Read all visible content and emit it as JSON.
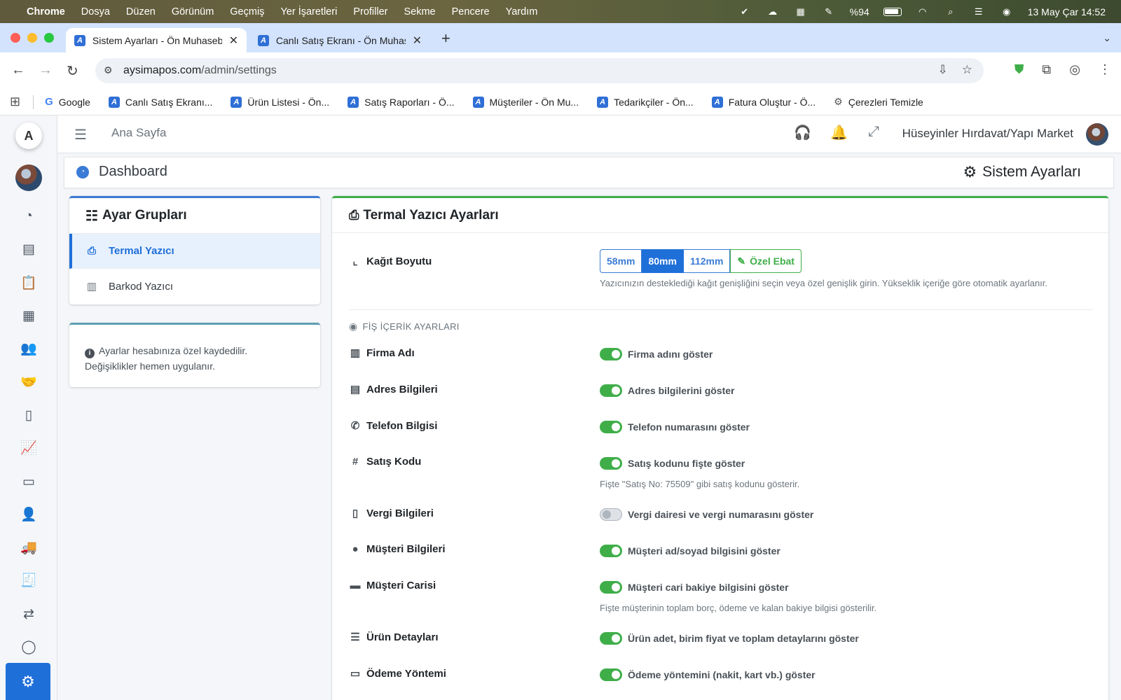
{
  "menubar": {
    "app": "Chrome",
    "items": [
      "Dosya",
      "Düzen",
      "Görünüm",
      "Geçmiş",
      "Yer İşaretleri",
      "Profiller",
      "Sekme",
      "Pencere",
      "Yardım"
    ],
    "battery": "%94",
    "datetime": "13 May Çar  14:52"
  },
  "tabs": [
    {
      "title": "Sistem Ayarları - Ön Muhaseb",
      "active": true
    },
    {
      "title": "Canlı Satış Ekranı - Ön Muhas",
      "active": false
    }
  ],
  "address": {
    "url_host": "aysimapos.com",
    "url_path": "/admin/settings"
  },
  "bookmarks": [
    "Google",
    "Canlı Satış Ekranı...",
    "Ürün Listesi - Ön...",
    "Satış Raporları - Ö...",
    "Müşteriler - Ön Mu...",
    "Tedarikçiler - Ön...",
    "Fatura Oluştur - Ö...",
    "Çerezleri Temizle"
  ],
  "topnav": {
    "home": "Ana Sayfa",
    "store_name": "Hüseyinler Hırdavat/Yapı Market"
  },
  "breadcrumb": {
    "left": "Dashboard",
    "right": "Sistem Ayarları"
  },
  "groups": {
    "title": "Ayar Grupları",
    "items": [
      {
        "label": "Termal Yazıcı",
        "icon": "printer-icon",
        "active": true
      },
      {
        "label": "Barkod Yazıcı",
        "icon": "barcode-icon",
        "active": false
      }
    ]
  },
  "info": {
    "line1": "Ayarlar hesabınıza özel kaydedilir.",
    "line2": "Değişiklikler hemen uygulanır."
  },
  "settings": {
    "title": "Termal Yazıcı Ayarları",
    "paper_label": "Kağıt Boyutu",
    "paper_options": [
      "58mm",
      "80mm",
      "112mm",
      "Özel Ebat"
    ],
    "paper_selected": "80mm",
    "paper_help": "Yazıcınızın desteklediği kağıt genişliğini seçin veya özel genişlik girin. Yükseklik içeriğe göre otomatik ayarlanır.",
    "section_title": "FİŞ İÇERİK AYARLARI",
    "rows": [
      {
        "label": "Firma Adı",
        "toggle": "Firma adını göster",
        "on": true,
        "help": ""
      },
      {
        "label": "Adres Bilgileri",
        "toggle": "Adres bilgilerini göster",
        "on": true,
        "help": ""
      },
      {
        "label": "Telefon Bilgisi",
        "toggle": "Telefon numarasını göster",
        "on": true,
        "help": ""
      },
      {
        "label": "Satış Kodu",
        "toggle": "Satış kodunu fişte göster",
        "on": true,
        "help": "Fişte \"Satış No: 75509\" gibi satış kodunu gösterir."
      },
      {
        "label": "Vergi Bilgileri",
        "toggle": "Vergi dairesi ve vergi numarasını göster",
        "on": false,
        "help": ""
      },
      {
        "label": "Müşteri Bilgileri",
        "toggle": "Müşteri ad/soyad bilgisini göster",
        "on": true,
        "help": ""
      },
      {
        "label": "Müşteri Carisi",
        "toggle": "Müşteri cari bakiye bilgisini göster",
        "on": true,
        "help": "Fişte müşterinin toplam borç, ödeme ve kalan bakiye bilgisi gösterilir."
      },
      {
        "label": "Ürün Detayları",
        "toggle": "Ürün adet, birim fiyat ve toplam detaylarını göster",
        "on": true,
        "help": ""
      },
      {
        "label": "Ödeme Yöntemi",
        "toggle": "Ödeme yöntemini (nakit, kart vb.) göster",
        "on": true,
        "help": ""
      }
    ]
  },
  "colors": {
    "primary": "#1f6fd9",
    "success": "#3fae49",
    "info_border": "#5fa0b4"
  }
}
